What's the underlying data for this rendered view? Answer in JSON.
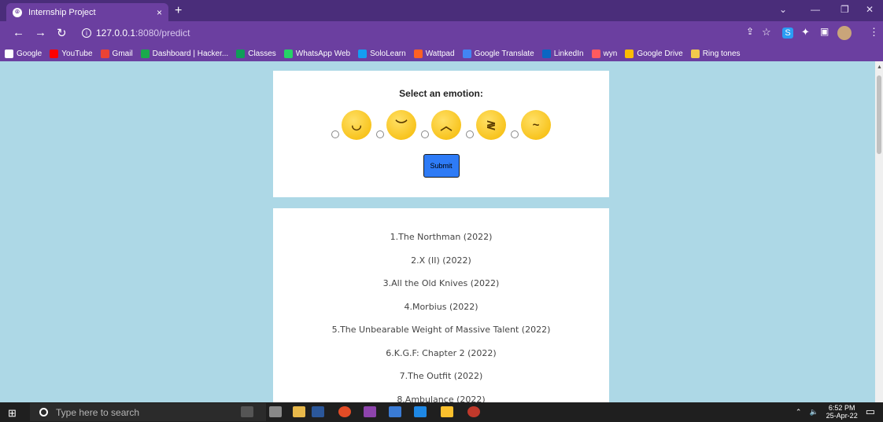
{
  "browser": {
    "tab_title": "Internship Project",
    "tab_close": "×",
    "new_tab": "+",
    "url_host": "127.0.0.1",
    "url_path": ":8080/predict",
    "bookmarks": [
      {
        "label": "Google",
        "color": "#ffffff"
      },
      {
        "label": "YouTube",
        "color": "#ff0000"
      },
      {
        "label": "Gmail",
        "color": "#ea4335"
      },
      {
        "label": "Dashboard | Hacker...",
        "color": "#1ba94c"
      },
      {
        "label": "Classes",
        "color": "#0f9d58"
      },
      {
        "label": "WhatsApp Web",
        "color": "#25d366"
      },
      {
        "label": "SoloLearn",
        "color": "#149ef2"
      },
      {
        "label": "Wattpad",
        "color": "#ff6122"
      },
      {
        "label": "Google Translate",
        "color": "#4285f4"
      },
      {
        "label": "LinkedIn",
        "color": "#0a66c2"
      },
      {
        "label": "wyn",
        "color": "#ff5a5f"
      },
      {
        "label": "Google Drive",
        "color": "#fbbc04"
      },
      {
        "label": "Ring tones",
        "color": "#f2c94c"
      }
    ]
  },
  "form": {
    "heading": "Select an emotion:",
    "emotions": [
      {
        "name": "happy",
        "glyph": "◡"
      },
      {
        "name": "sad",
        "glyph": "︶"
      },
      {
        "name": "angry",
        "glyph": "︿"
      },
      {
        "name": "disgusted",
        "glyph": "≷"
      },
      {
        "name": "thinking",
        "glyph": "~"
      }
    ],
    "submit_label": "Submit"
  },
  "results": {
    "movies": [
      "1.The Northman (2022)",
      "2.X (II) (2022)",
      "3.All the Old Knives (2022)",
      "4.Morbius (2022)",
      "5.The Unbearable Weight of Massive Talent (2022)",
      "6.K.G.F: Chapter 2 (2022)",
      "7.The Outfit (2022)",
      "8.Ambulance (2022)"
    ]
  },
  "taskbar": {
    "search_placeholder": "Type here to search",
    "time": "6:52 PM",
    "date": "25-Apr-22"
  },
  "colors": {
    "page_bg": "#add8e6",
    "chrome_purple": "#6b3fa0",
    "submit_blue": "#2e7bf6"
  }
}
